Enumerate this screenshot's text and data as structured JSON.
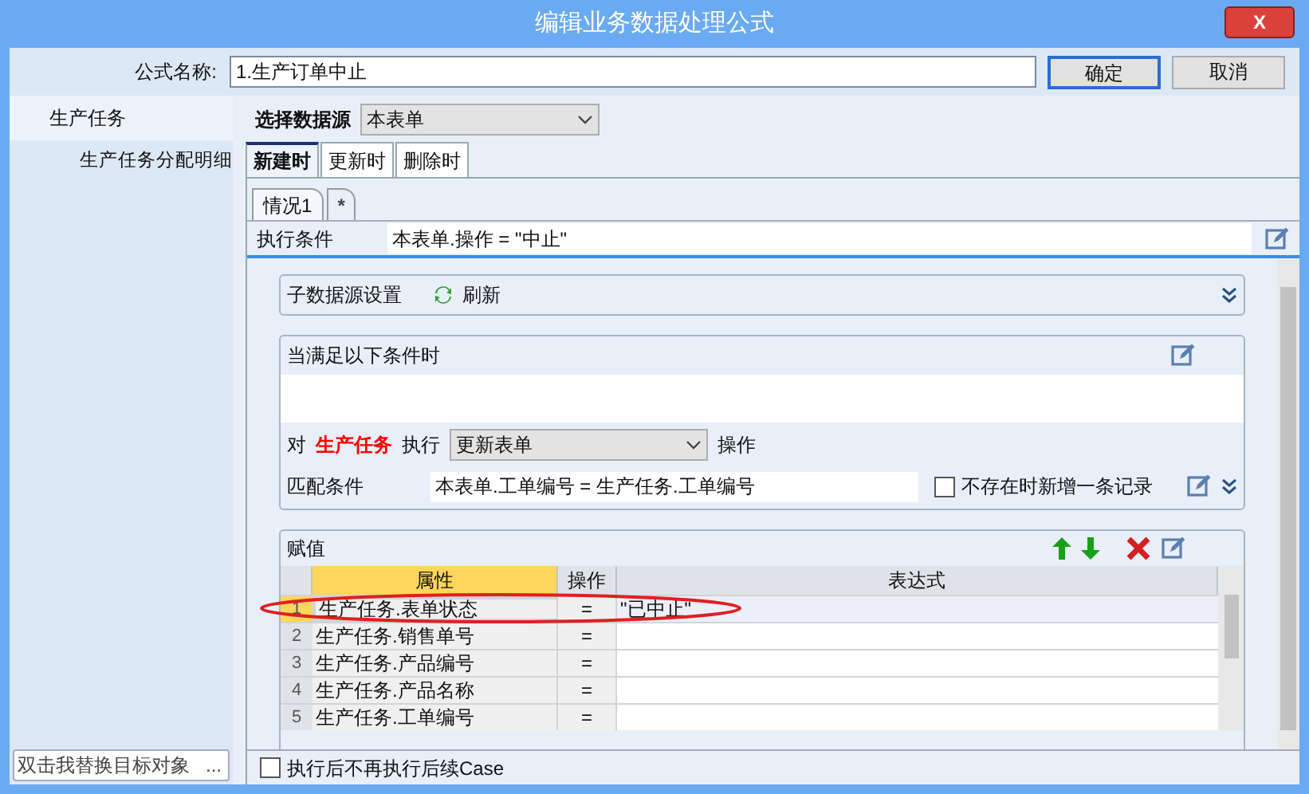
{
  "window": {
    "title": "编辑业务数据处理公式",
    "close": "X"
  },
  "formula_name": {
    "label": "公式名称:",
    "value": "1.生产订单中止"
  },
  "buttons": [
    {
      "label": "确定",
      "selected": true
    },
    {
      "label": "取消",
      "selected": false
    }
  ],
  "sidebar": {
    "items": [
      {
        "label": "生产任务",
        "selected": true,
        "children": [
          {
            "label": "生产任务分配明细",
            "selected": false
          }
        ]
      }
    ],
    "target_field": {
      "value": "双击我替换目标对象",
      "button": "..."
    }
  },
  "datasource": {
    "label": "选择数据源",
    "value": "本表单"
  },
  "tabs": [
    {
      "label": "新建时",
      "selected": true
    },
    {
      "label": "更新时",
      "selected": false
    },
    {
      "label": "删除时",
      "selected": false
    }
  ],
  "case_tabs": [
    {
      "label": "情况1",
      "selected": true
    },
    {
      "label": "*",
      "selected": false
    }
  ],
  "condition": {
    "label": "执行条件",
    "value": "本表单.操作 = \"中止\""
  },
  "sub_datasource": {
    "title": "子数据源设置",
    "refresh": "刷新"
  },
  "when_panel": {
    "title": "当满足以下条件时",
    "prefix": "对",
    "target": "生产任务",
    "verb": "执行",
    "action": "更新表单",
    "suffix": "操作",
    "match_label": "匹配条件",
    "match_value": "本表单.工单编号 = 生产任务.工单编号",
    "add_if_missing": {
      "label": "不存在时新增一条记录",
      "checked": false
    }
  },
  "assign_panel": {
    "title": "赋值",
    "columns": [
      "属性",
      "操作",
      "表达式"
    ],
    "rows": [
      {
        "num": "1",
        "property": "生产任务.表单状态",
        "op": "=",
        "expression": "\"已中止\"",
        "selected": true
      },
      {
        "num": "2",
        "property": "生产任务.销售单号",
        "op": "=",
        "expression": "",
        "selected": false
      },
      {
        "num": "3",
        "property": "生产任务.产品编号",
        "op": "=",
        "expression": "",
        "selected": false
      },
      {
        "num": "4",
        "property": "生产任务.产品名称",
        "op": "=",
        "expression": "",
        "selected": false
      },
      {
        "num": "5",
        "property": "生产任务.工单编号",
        "op": "=",
        "expression": "",
        "selected": false
      }
    ]
  },
  "footer": {
    "label": "执行后不再执行后续Case",
    "checked": false
  }
}
